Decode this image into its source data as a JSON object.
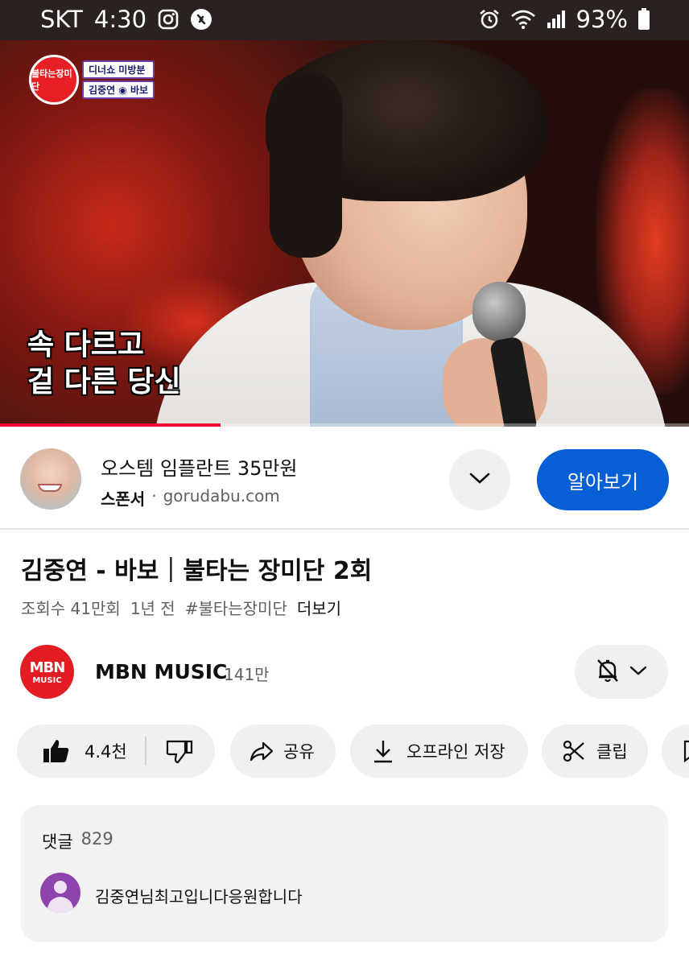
{
  "status_bar": {
    "carrier": "SKT",
    "time": "4:30",
    "battery": "93%"
  },
  "video": {
    "show_logo": "불타는장미단",
    "show_tag_1": "디너쇼 미방분",
    "show_tag_2": "김중연 ◉ 바보",
    "subtitle_line_1": "속 다르고",
    "subtitle_line_2": "겉 다른 당신",
    "progress_fraction": 0.32
  },
  "ad": {
    "title": "오스템 임플란트 35만원",
    "sponsor_label": "스폰서",
    "separator": "·",
    "domain": "gorudabu.com",
    "cta_label": "알아보기"
  },
  "video_info": {
    "title": "김중연 - 바보｜불타는 장미단 2회",
    "views": "조회수 41만회",
    "age": "1년 전",
    "hashtag": "#불타는장미단",
    "more_label": "더보기"
  },
  "channel": {
    "avatar_text_1": "MBN",
    "avatar_text_2": "MUSIC",
    "name": "MBN MUSIC",
    "subscribers": "141만"
  },
  "actions": {
    "like_count": "4.4천",
    "share_label": "공유",
    "download_label": "오프라인 저장",
    "clip_label": "클립"
  },
  "comments": {
    "label": "댓글",
    "count": "829",
    "top_comment": "김중연님최고입니다응원합니다"
  },
  "colors": {
    "accent_blue": "#065fd4",
    "progress_red": "#ff0033",
    "channel_red": "#e31c23",
    "pill_bg": "#f0f0f0"
  }
}
